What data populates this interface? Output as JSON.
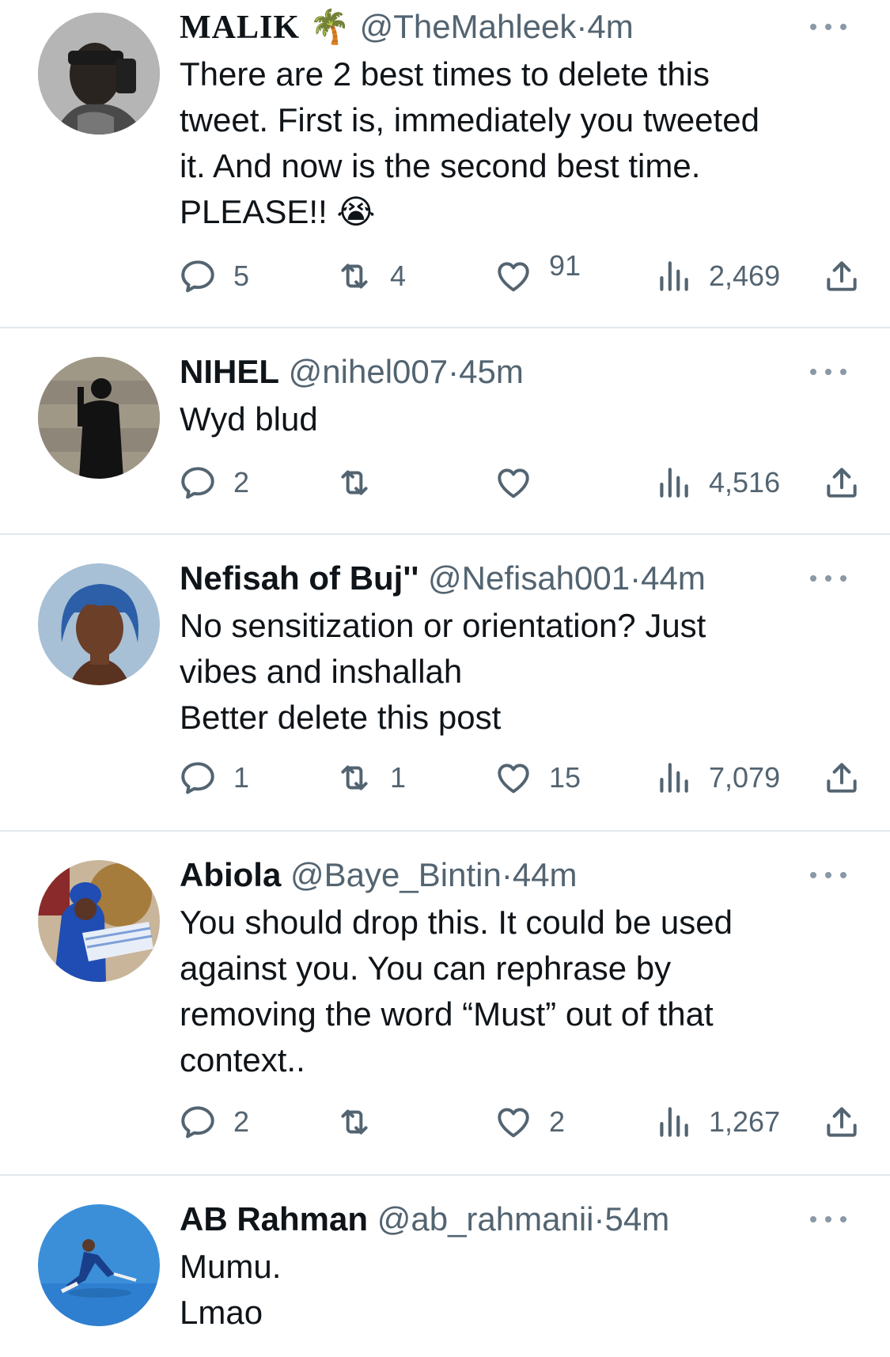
{
  "tweets": [
    {
      "name": "MALIK",
      "name_emoji": "🌴",
      "handle": "@TheMahleek",
      "separator": "·",
      "time": "4m",
      "body_lines": [
        "There are 2 best times to delete this",
        "tweet. First is, immediately you tweeted",
        "it. And now is the second best time.",
        "PLEASE!! 😭"
      ],
      "replies": "5",
      "retweets": "4",
      "likes": "91",
      "views": "2,469"
    },
    {
      "name": "NIHEL",
      "handle": "@nihel007",
      "separator": "·",
      "time": "45m",
      "body_lines": [
        "Wyd blud"
      ],
      "replies": "2",
      "retweets": "",
      "likes": "",
      "views": "4,516"
    },
    {
      "name": "Nefisah of Buj''",
      "handle": "@Nefisah001",
      "separator": "·",
      "time": "44m",
      "body_lines": [
        "No sensitization or orientation? Just",
        "vibes and inshallah",
        "Better delete this post"
      ],
      "replies": "1",
      "retweets": "1",
      "likes": "15",
      "views": "7,079"
    },
    {
      "name": "Abiola",
      "handle": "@Baye_Bintin",
      "separator": "·",
      "time": "44m",
      "body_lines": [
        "You should drop this. It could be used",
        "against you. You can rephrase by",
        "removing the word “Must” out of that",
        "context.."
      ],
      "replies": "2",
      "retweets": "",
      "likes": "2",
      "views": "1,267"
    },
    {
      "name": "AB Rahman",
      "handle": "@ab_rahmanii",
      "separator": "·",
      "time": "54m",
      "body_lines": [
        "Mumu.",
        "Lmao"
      ]
    }
  ],
  "icons": {
    "reply": "reply-icon",
    "retweet": "retweet-icon",
    "like": "heart-icon",
    "views": "views-icon",
    "share": "share-icon",
    "more": "more-icon"
  },
  "colors": {
    "text": "#0f1419",
    "secondary": "#536471",
    "divider": "#e1e8ed"
  }
}
